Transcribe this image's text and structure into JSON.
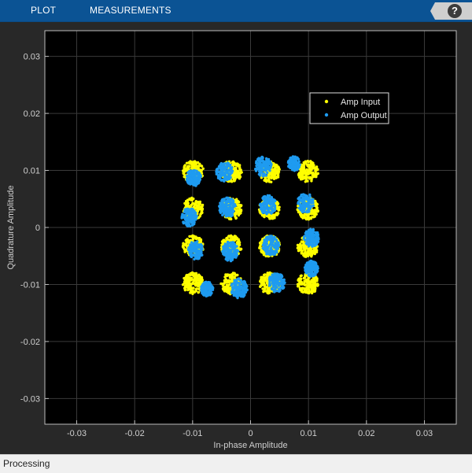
{
  "toolbar": {
    "tabs": [
      "PLOT",
      "MEASUREMENTS"
    ],
    "help_label": "?"
  },
  "status": {
    "text": "Processing"
  },
  "colors": {
    "background": "#000000",
    "figure": "#282828",
    "grid": "#3a3a3a",
    "axis_text": "#cfcfcf",
    "input": "#ffff00",
    "output": "#1e9bf0"
  },
  "chart_data": {
    "type": "scatter",
    "title": "",
    "xlabel": "In-phase Amplitude",
    "ylabel": "Quadrature Amplitude",
    "xlim": [
      -0.0355,
      0.0355
    ],
    "ylim": [
      -0.0345,
      0.0345
    ],
    "xticks": [
      -0.03,
      -0.02,
      -0.01,
      0,
      0.01,
      0.02,
      0.03
    ],
    "xtick_labels": [
      "-0.03",
      "-0.02",
      "-0.01",
      "0",
      "0.01",
      "0.02",
      "0.03"
    ],
    "yticks": [
      -0.03,
      -0.02,
      -0.01,
      0,
      0.01,
      0.02,
      0.03
    ],
    "ytick_labels": [
      "-0.03",
      "-0.02",
      "-0.01",
      "0",
      "0.01",
      "0.02",
      "0.03"
    ],
    "grid": true,
    "legend_position": "top-right",
    "series": [
      {
        "name": "Amp Input",
        "color": "#ffff00",
        "clusters": [
          {
            "x": -0.0099,
            "y": 0.0098,
            "spread": 0.0018
          },
          {
            "x": -0.0033,
            "y": 0.0098,
            "spread": 0.0018
          },
          {
            "x": 0.0033,
            "y": 0.0098,
            "spread": 0.0018
          },
          {
            "x": 0.0099,
            "y": 0.0098,
            "spread": 0.0018
          },
          {
            "x": -0.0099,
            "y": 0.0033,
            "spread": 0.0018
          },
          {
            "x": -0.0033,
            "y": 0.0033,
            "spread": 0.0018
          },
          {
            "x": 0.0033,
            "y": 0.0033,
            "spread": 0.0018
          },
          {
            "x": 0.0099,
            "y": 0.0033,
            "spread": 0.0018
          },
          {
            "x": -0.0099,
            "y": -0.0033,
            "spread": 0.0018
          },
          {
            "x": -0.0033,
            "y": -0.0033,
            "spread": 0.0018
          },
          {
            "x": 0.0033,
            "y": -0.0033,
            "spread": 0.0018
          },
          {
            "x": 0.0099,
            "y": -0.0033,
            "spread": 0.0018
          },
          {
            "x": -0.0099,
            "y": -0.0098,
            "spread": 0.0018
          },
          {
            "x": -0.0033,
            "y": -0.0098,
            "spread": 0.0018
          },
          {
            "x": 0.0033,
            "y": -0.0098,
            "spread": 0.0018
          },
          {
            "x": 0.0099,
            "y": -0.0098,
            "spread": 0.0018
          }
        ]
      },
      {
        "name": "Amp Output",
        "color": "#1e9bf0",
        "clusters": [
          {
            "x": -0.0098,
            "y": 0.0087,
            "spread": 0.0013
          },
          {
            "x": -0.0045,
            "y": 0.0098,
            "spread": 0.0015
          },
          {
            "x": 0.0022,
            "y": 0.0107,
            "spread": 0.0015
          },
          {
            "x": 0.0075,
            "y": 0.0112,
            "spread": 0.0011
          },
          {
            "x": -0.0106,
            "y": 0.0018,
            "spread": 0.0014
          },
          {
            "x": -0.004,
            "y": 0.0035,
            "spread": 0.0015
          },
          {
            "x": 0.003,
            "y": 0.0039,
            "spread": 0.0015
          },
          {
            "x": 0.0095,
            "y": 0.0043,
            "spread": 0.0015
          },
          {
            "x": -0.0095,
            "y": -0.004,
            "spread": 0.0014
          },
          {
            "x": -0.0035,
            "y": -0.0042,
            "spread": 0.0015
          },
          {
            "x": 0.0035,
            "y": -0.0032,
            "spread": 0.0015
          },
          {
            "x": 0.0105,
            "y": -0.0018,
            "spread": 0.0014
          },
          {
            "x": -0.0075,
            "y": -0.0108,
            "spread": 0.0011
          },
          {
            "x": -0.002,
            "y": -0.0107,
            "spread": 0.0015
          },
          {
            "x": 0.0045,
            "y": -0.0097,
            "spread": 0.0015
          },
          {
            "x": 0.0105,
            "y": -0.0072,
            "spread": 0.0012
          }
        ]
      }
    ]
  }
}
